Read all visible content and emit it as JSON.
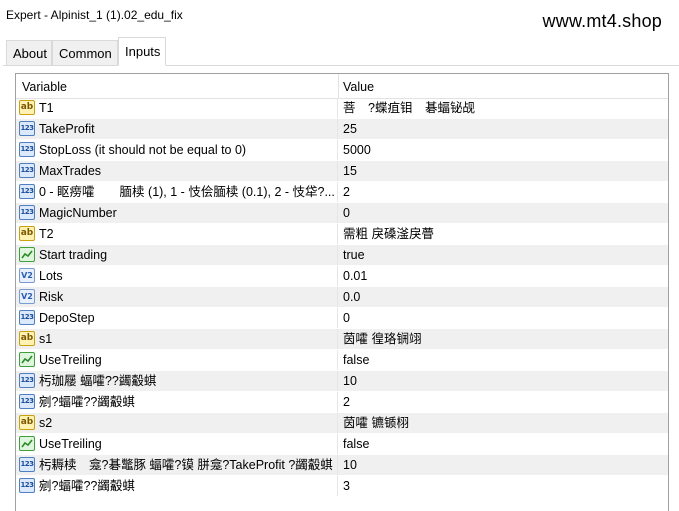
{
  "window": {
    "title": "Expert - Alpinist_1 (1).02_edu_fix",
    "watermark": "www.mt4.shop"
  },
  "tabs": [
    {
      "label": "About",
      "active": false
    },
    {
      "label": "Common",
      "active": false
    },
    {
      "label": "Inputs",
      "active": true
    }
  ],
  "table": {
    "headers": {
      "variable": "Variable",
      "value": "Value"
    },
    "rows": [
      {
        "icon": "string-icon",
        "type": "ab",
        "variable": "T1",
        "value": "菩　?蝶疽钼　碁蝠铋觇"
      },
      {
        "icon": "integer-icon",
        "type": "123",
        "variable": "TakeProfit",
        "value": "25"
      },
      {
        "icon": "integer-icon",
        "type": "123",
        "variable": "StopLoss (it should not be equal to 0)",
        "value": "5000"
      },
      {
        "icon": "integer-icon",
        "type": "123",
        "variable": "MaxTrades",
        "value": "15"
      },
      {
        "icon": "integer-icon",
        "type": "123",
        "variable": "0 - 眍痨嚯　　腼椟 (1), 1 - 忮侩腼椟 (0.1), 2 - 忮牮?...",
        "value": "2"
      },
      {
        "icon": "integer-icon",
        "type": "123",
        "variable": "MagicNumber",
        "value": "0"
      },
      {
        "icon": "string-icon",
        "type": "ab",
        "variable": "T2",
        "value": "需粗 戾磉滏戾瞢"
      },
      {
        "icon": "boolean-icon",
        "type": "bool",
        "variable": "Start trading",
        "value": "true"
      },
      {
        "icon": "double-icon",
        "type": "v2",
        "variable": "Lots",
        "value": "0.01"
      },
      {
        "icon": "double-icon",
        "type": "v2",
        "variable": "Risk",
        "value": "0.0"
      },
      {
        "icon": "integer-icon",
        "type": "123",
        "variable": "DepoStep",
        "value": "0"
      },
      {
        "icon": "string-icon",
        "type": "ab",
        "variable": "s1",
        "value": "茵嚯 徨珞锎翊"
      },
      {
        "icon": "boolean-icon",
        "type": "bool",
        "variable": "UseTreiling",
        "value": "false"
      },
      {
        "icon": "integer-icon",
        "type": "123",
        "variable": "杇珈屦 蝠嚯??蠲觳蜞",
        "value": "10"
      },
      {
        "icon": "integer-icon",
        "type": "123",
        "variable": "剜?蝠嚯??蠲觳蜞",
        "value": "2"
      },
      {
        "icon": "string-icon",
        "type": "ab",
        "variable": "s2",
        "value": "茵嚯 镳锧栩"
      },
      {
        "icon": "boolean-icon",
        "type": "bool",
        "variable": "UseTreiling",
        "value": "false"
      },
      {
        "icon": "integer-icon",
        "type": "123",
        "variable": "杇耨椟　龛?碁鼈豚 蝠嚯?镆 胼龛?TakeProfit ?蠲觳蜞",
        "value": "10"
      },
      {
        "icon": "integer-icon",
        "type": "123",
        "variable": "剜?蝠嚯??蠲觳蜞",
        "value": "3"
      }
    ]
  }
}
